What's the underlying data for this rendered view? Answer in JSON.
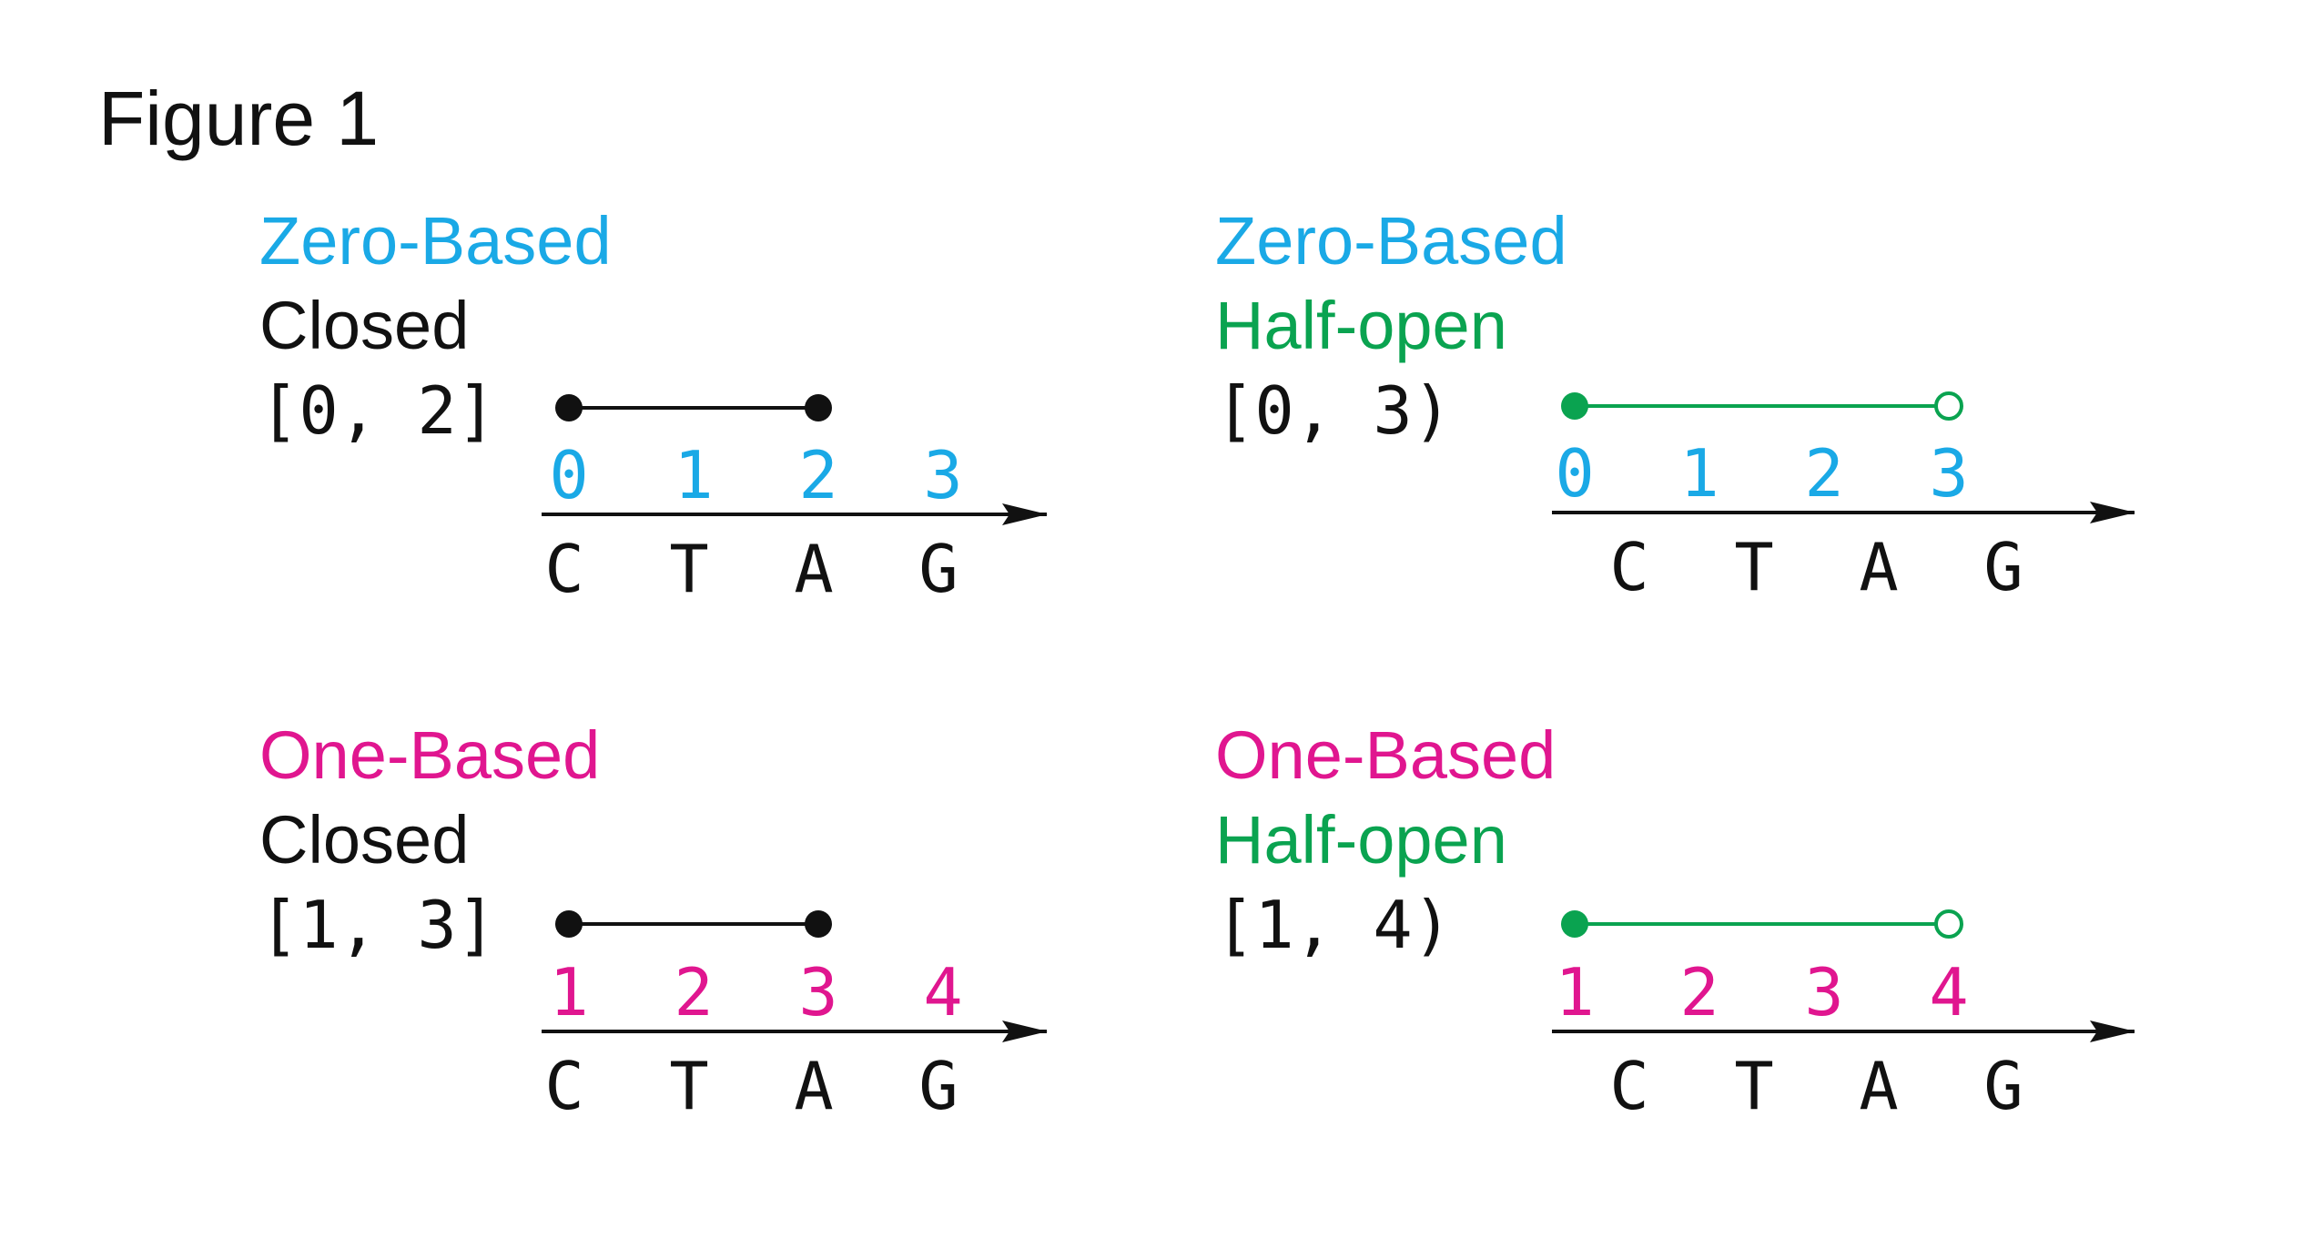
{
  "figure_title": "Figure 1",
  "colors": {
    "zero_based": "#1aa9e6",
    "one_based": "#e0168f",
    "half_open": "#0aa350",
    "closed": "#111111"
  },
  "panels": [
    {
      "basis": "Zero-Based",
      "interval": "Closed",
      "notation": "[0, 2]",
      "positions": [
        "0",
        "1",
        "2",
        "3"
      ],
      "bases": [
        "C",
        "T",
        "A",
        "G"
      ],
      "start": 0,
      "end": 2,
      "end_open": false
    },
    {
      "basis": "Zero-Based",
      "interval": "Half-open",
      "notation": "[0, 3)",
      "positions": [
        "0",
        "1",
        "2",
        "3"
      ],
      "bases": [
        "C",
        "T",
        "A",
        "G"
      ],
      "start": 0,
      "end": 3,
      "end_open": true
    },
    {
      "basis": "One-Based",
      "interval": "Closed",
      "notation": "[1, 3]",
      "positions": [
        "1",
        "2",
        "3",
        "4"
      ],
      "bases": [
        "C",
        "T",
        "A",
        "G"
      ],
      "start": 1,
      "end": 3,
      "end_open": false
    },
    {
      "basis": "One-Based",
      "interval": "Half-open",
      "notation": "[1, 4)",
      "positions": [
        "1",
        "2",
        "3",
        "4"
      ],
      "bases": [
        "C",
        "T",
        "A",
        "G"
      ],
      "start": 1,
      "end": 4,
      "end_open": true
    }
  ]
}
